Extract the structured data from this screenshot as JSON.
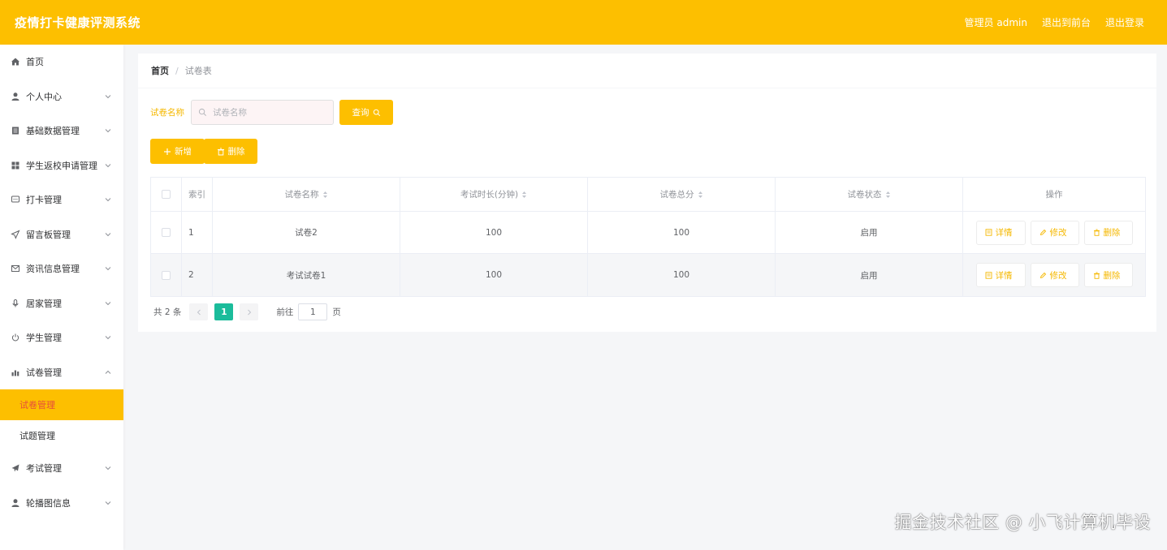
{
  "app": {
    "title": "疫情打卡健康评测系统"
  },
  "header": {
    "user_label": "管理员 admin",
    "front_link": "退出到前台",
    "logout_link": "退出登录"
  },
  "colors": {
    "accent": "#fdbf00",
    "pager_active": "#1bbc9b"
  },
  "sidebar": {
    "items": [
      {
        "label": "首页",
        "icon": "home-icon"
      },
      {
        "label": "个人中心",
        "icon": "user-icon"
      },
      {
        "label": "基础数据管理",
        "icon": "document-icon"
      },
      {
        "label": "学生返校申请管理",
        "icon": "grid-icon"
      },
      {
        "label": "打卡管理",
        "icon": "chat-icon"
      },
      {
        "label": "留言板管理",
        "icon": "send-icon"
      },
      {
        "label": "资讯信息管理",
        "icon": "mail-icon"
      },
      {
        "label": "居家管理",
        "icon": "microphone-icon"
      },
      {
        "label": "学生管理",
        "icon": "power-icon"
      },
      {
        "label": "试卷管理",
        "icon": "chart-icon"
      },
      {
        "label": "考试管理",
        "icon": "plane-icon"
      },
      {
        "label": "轮播图信息",
        "icon": "user-icon"
      }
    ],
    "sub_items": [
      {
        "label": "试卷管理"
      },
      {
        "label": "试题管理"
      }
    ]
  },
  "breadcrumb": {
    "home": "首页",
    "separator": "/",
    "current": "试卷表"
  },
  "search": {
    "label": "试卷名称",
    "placeholder": "试卷名称",
    "value": "",
    "button": "查询"
  },
  "toolbar": {
    "add": "新增",
    "delete": "删除"
  },
  "table": {
    "headers": {
      "index": "索引",
      "name": "试卷名称",
      "duration": "考试时长(分钟)",
      "total": "试卷总分",
      "status": "试卷状态",
      "ops": "操作"
    },
    "rows": [
      {
        "index": "1",
        "name": "试卷2",
        "duration": "100",
        "total": "100",
        "status": "启用"
      },
      {
        "index": "2",
        "name": "考试试卷1",
        "duration": "100",
        "total": "100",
        "status": "启用"
      }
    ],
    "actions": {
      "detail": "详情",
      "edit": "修改",
      "remove": "删除"
    }
  },
  "pagination": {
    "total_text": "共 2 条",
    "current_page": "1",
    "goto_prefix": "前往",
    "goto_value": "1",
    "goto_suffix": "页"
  },
  "watermark": "掘金技术社区 @ 小飞计算机毕设"
}
